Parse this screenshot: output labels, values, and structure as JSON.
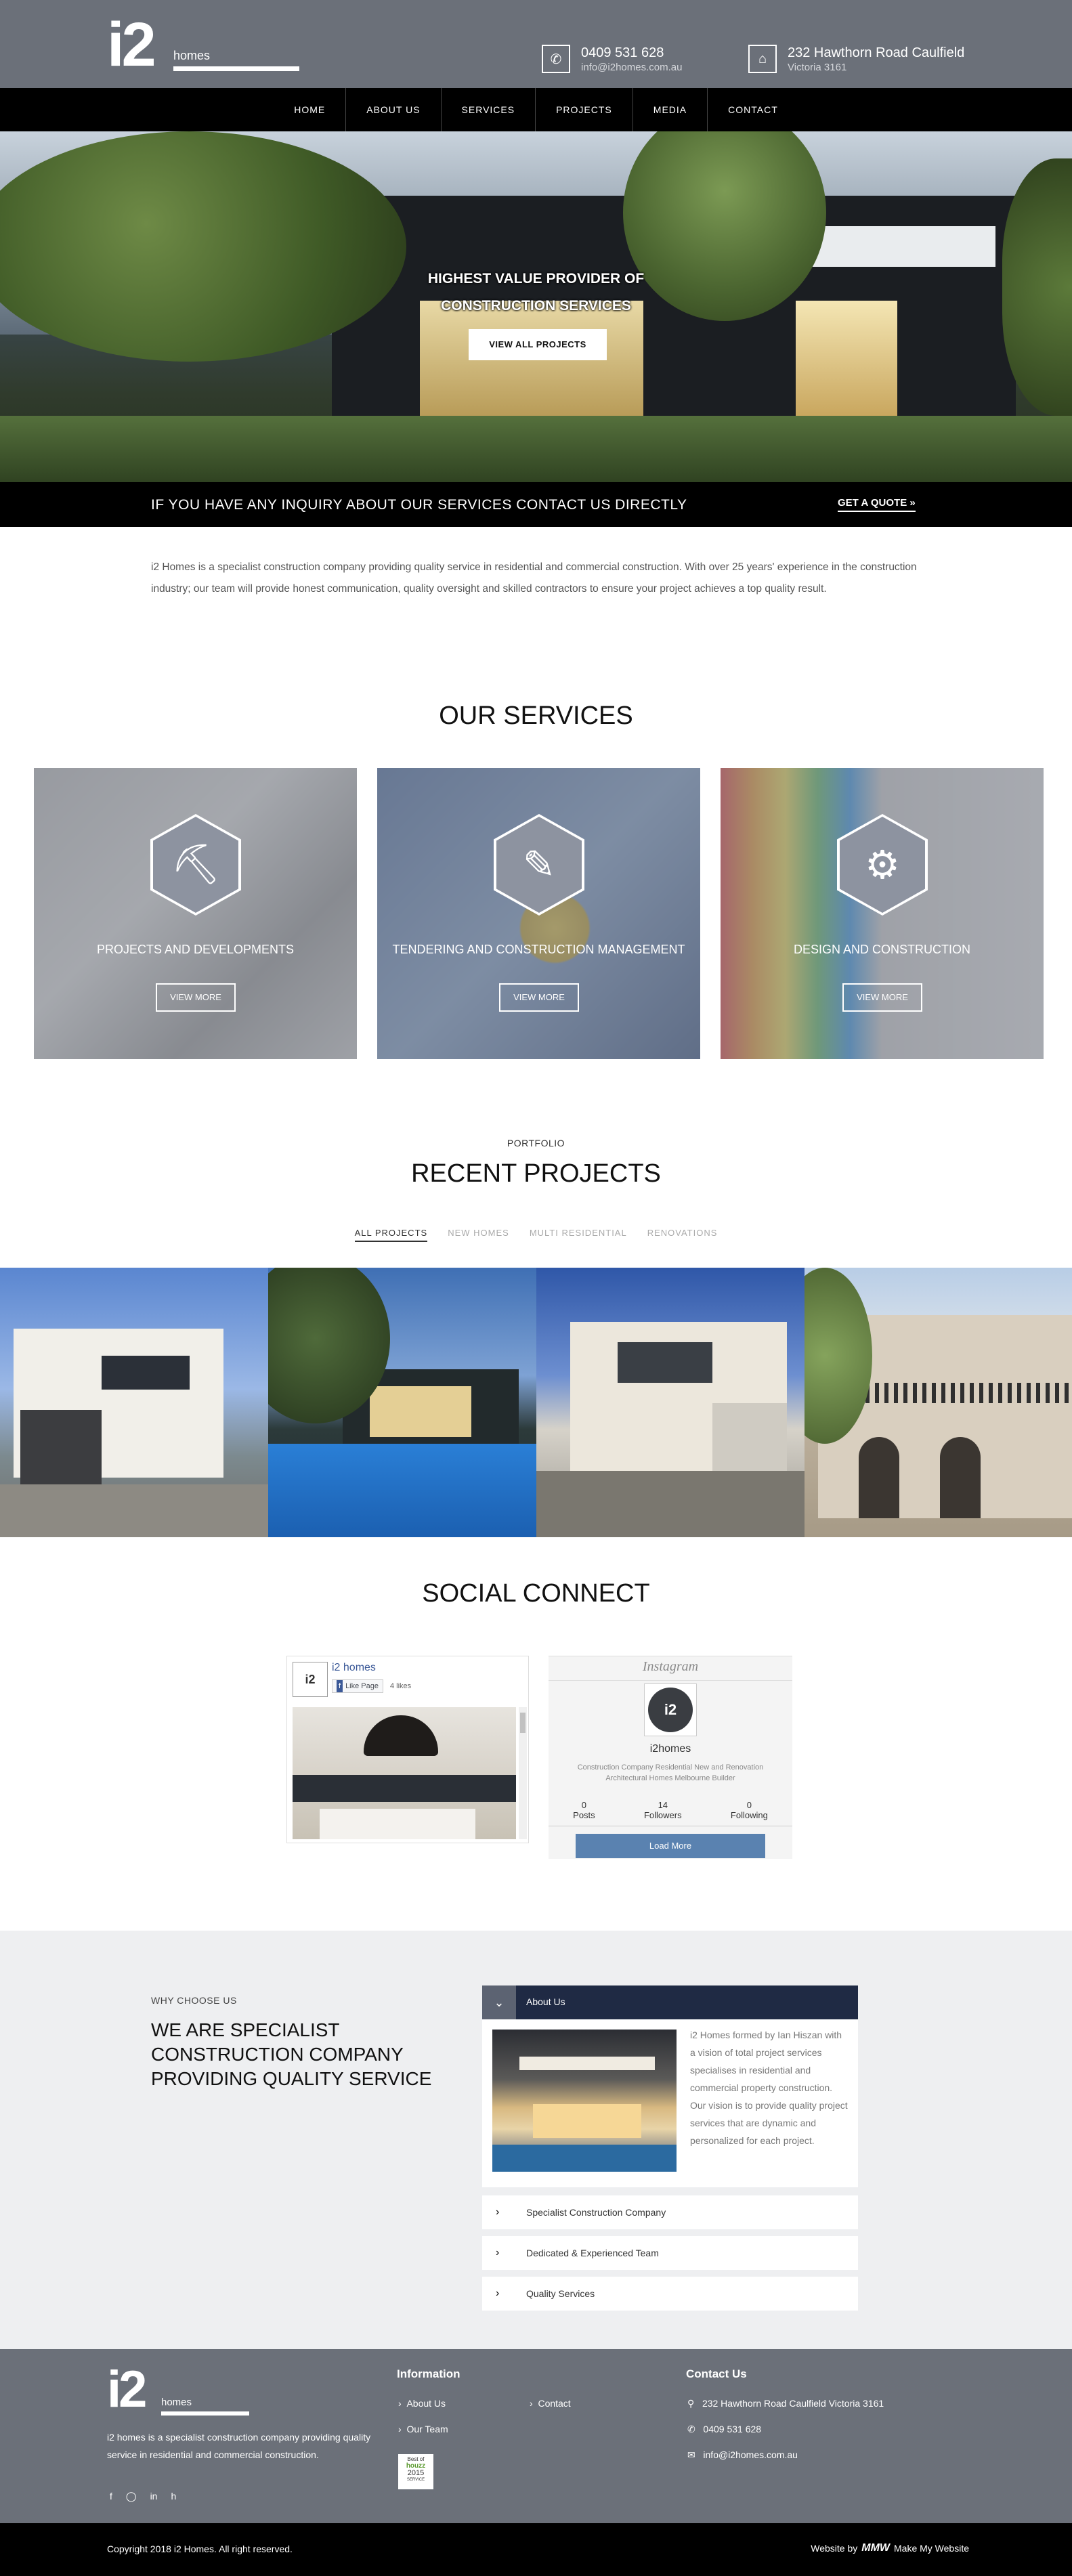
{
  "header": {
    "logo_big": "i2",
    "logo_small": "homes",
    "phone": "0409 531 628",
    "email": "info@i2homes.com.au",
    "address_l1": "232 Hawthorn Road Caulfield",
    "address_l2": "Victoria 3161",
    "phone_icon": "phone-icon",
    "home_icon": "home-icon"
  },
  "nav": [
    "HOME",
    "ABOUT US",
    "SERVICES",
    "PROJECTS",
    "MEDIA",
    "CONTACT"
  ],
  "hero": {
    "title_l1": "HIGHEST VALUE PROVIDER OF",
    "title_l2": "CONSTRUCTION SERVICES",
    "button": "VIEW ALL PROJECTS"
  },
  "inquiry": {
    "text": "IF YOU HAVE ANY INQUIRY ABOUT OUR SERVICES CONTACT US DIRECTLY",
    "button": "GET A QUOTE  »"
  },
  "intro": "i2 Homes is a specialist construction company providing quality service in residential and commercial construction. With over 25 years' experience in the construction industry; our team will provide honest communication, quality oversight and skilled contractors to ensure your project achieves a top quality result.",
  "services": {
    "title": "OUR SERVICES",
    "items": [
      {
        "title": "PROJECTS AND DEVELOPMENTS",
        "button": "VIEW MORE",
        "icon": "worker-icon"
      },
      {
        "title": "TENDERING AND CONSTRUCTION MANAGEMENT",
        "button": "VIEW MORE",
        "icon": "edit-icon"
      },
      {
        "title": "DESIGN AND CONSTRUCTION",
        "button": "VIEW MORE",
        "icon": "gear-person-icon"
      }
    ]
  },
  "portfolio": {
    "eyebrow": "PORTFOLIO",
    "title": "RECENT PROJECTS",
    "filters": [
      "ALL PROJECTS",
      "NEW HOMES",
      "MULTI RESIDENTIAL",
      "RENOVATIONS"
    ]
  },
  "social": {
    "title": "SOCIAL CONNECT",
    "fb_name": "i2 homes",
    "fb_like": "Like Page",
    "fb_likes": "4 likes",
    "ig_brand": "Instagram",
    "ig_user": "i2homes",
    "ig_bio": "Construction Company Residential New and Renovation Architectural Homes Melbourne Builder",
    "ig_posts": "0",
    "ig_posts_label": "Posts",
    "ig_followers": "14",
    "ig_followers_label": "Followers",
    "ig_following": "0",
    "ig_following_label": "Following",
    "ig_button": "Load More"
  },
  "why": {
    "eyebrow": "WHY CHOOSE US",
    "title_l1": "WE ARE SPECIALIST",
    "title_l2": "CONSTRUCTION COMPANY",
    "title_l3": "PROVIDING QUALITY SERVICE",
    "accordion_head": "About Us",
    "accordion_body": "i2 Homes formed by Ian Hiszan with a vision of total project services specialises in residential and commercial property construction. Our vision is to provide quality project services that are dynamic and personalized for each project.",
    "items": [
      "Specialist Construction Company",
      "Dedicated & Experienced Team",
      "Quality Services"
    ]
  },
  "footer": {
    "about": "i2 homes is a specialist construction company providing quality service in residential and commercial construction.",
    "info_title": "Information",
    "info_links": [
      "About Us",
      "Our Team",
      "Contact"
    ],
    "houzz_l1": "Best of",
    "houzz_l2": "houzz",
    "houzz_l3": "2015",
    "houzz_l4": "SERVICE",
    "contact_title": "Contact Us",
    "contact_address": "232 Hawthorn Road Caulfield Victoria 3161",
    "contact_phone": "0409 531 628",
    "contact_email": "info@i2homes.com.au",
    "social_icons": [
      "facebook-icon",
      "instagram-icon",
      "linkedin-icon",
      "houzz-icon"
    ]
  },
  "copyright": {
    "text": "Copyright 2018 i2 Homes. All right reserved.",
    "credit_prefix": "Website by",
    "credit_logo": "MMW",
    "credit_name": "Make My Website"
  },
  "colors": {
    "header_bg": "#6b7079",
    "nav_bg": "#000000",
    "accordion_head": "#1f2a44",
    "load_more": "#5a82b0"
  }
}
